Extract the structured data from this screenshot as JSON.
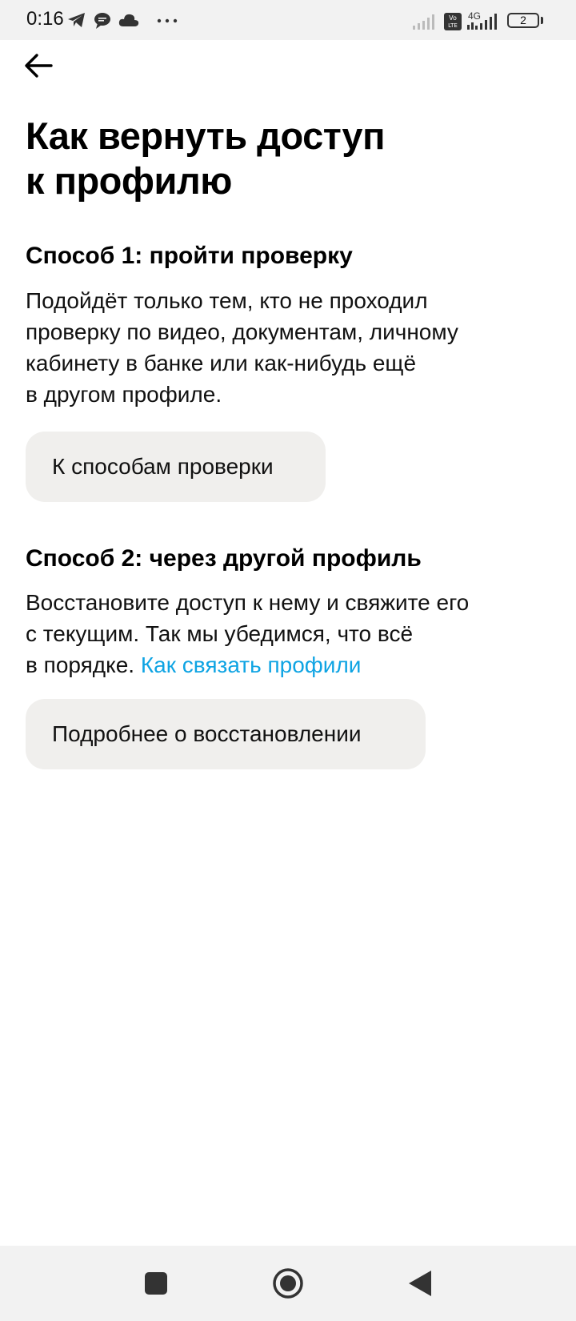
{
  "status_bar": {
    "time": "0:16",
    "icons": [
      "telegram-icon",
      "chat-bubble-icon",
      "cloud-icon",
      "more-dots-icon",
      "signal-icon",
      "volte-icon",
      "signal-4g-icon"
    ],
    "network_label": "4G",
    "battery_level": "2"
  },
  "header": {
    "back_icon": "arrow-left-icon"
  },
  "page": {
    "title_lines": [
      "Как вернуть доступ",
      "к профилю"
    ]
  },
  "method1": {
    "heading": "Способ 1: пройти проверку",
    "body_lines": [
      "Подойдёт только тем, кто не проходил",
      "проверку по видео, документам, личному",
      "кабинету в банке или как-нибудь ещё",
      "в другом профиле."
    ],
    "button_label": "К способам проверки"
  },
  "method2": {
    "heading": "Способ 2: через другой профиль",
    "body_lines": [
      "Восстановите доступ к нему и свяжите его",
      "с текущим. Так мы убедимся, что всё"
    ],
    "body_last_prefix": "в порядке. ",
    "link_text": "Как связать профили",
    "button_label": "Подробнее о восстановлении"
  },
  "nav_bar": {
    "buttons": [
      "recent-apps-icon",
      "home-icon",
      "back-triangle-icon"
    ]
  },
  "colors": {
    "link": "#0fa4e3",
    "button_bg": "#f0efed",
    "bar_bg": "#f2f2f2"
  }
}
